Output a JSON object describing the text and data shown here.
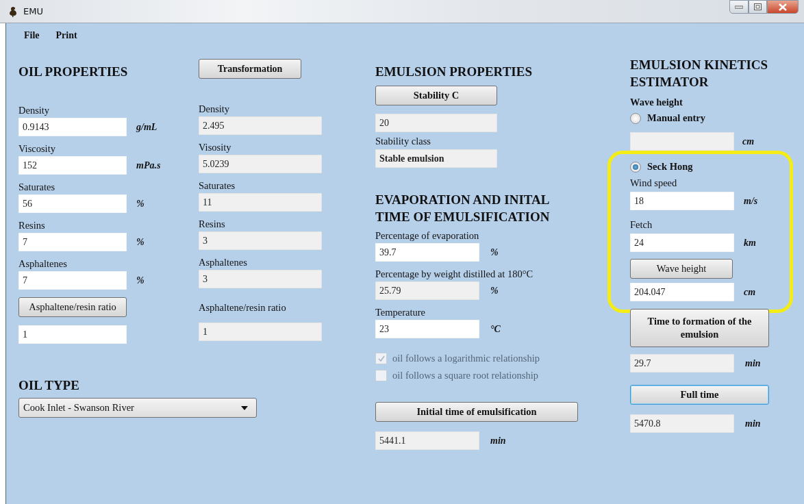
{
  "window": {
    "title": "EMU"
  },
  "menu": [
    {
      "label": "File"
    },
    {
      "label": "Print"
    }
  ],
  "oil_properties": {
    "title": "OIL PROPERTIES",
    "fields": [
      {
        "label": "Density",
        "value": "0.9143",
        "unit": "g/mL"
      },
      {
        "label": "Viscosity",
        "value": "152",
        "unit": "mPa.s"
      },
      {
        "label": "Saturates",
        "value": "56",
        "unit": "%"
      },
      {
        "label": "Resins",
        "value": "7",
        "unit": "%"
      },
      {
        "label": "Asphaltenes",
        "value": "7",
        "unit": "%"
      }
    ],
    "ratio_button": "Asphaltene/resin ratio",
    "ratio_value": "1"
  },
  "transformation": {
    "button": "Transformation",
    "fields": [
      {
        "label": "Density",
        "value": "2.495"
      },
      {
        "label": "Visosity",
        "value": "5.0239"
      },
      {
        "label": "Saturates",
        "value": "11"
      },
      {
        "label": "Resins",
        "value": "3"
      },
      {
        "label": "Asphaltenes",
        "value": "3"
      }
    ],
    "ratio_label": "Asphaltene/resin ratio",
    "ratio_value": "1"
  },
  "oil_type": {
    "title": "OIL TYPE",
    "selected": "Cook Inlet - Swanson River"
  },
  "emulsion_properties": {
    "title": "EMULSION PROPERTIES",
    "button": "Stability C",
    "value": "20",
    "class_label": "Stability class",
    "class_value": "Stable emulsion"
  },
  "evaporation": {
    "title": "EVAPORATION AND INITAL TIME OF EMULSIFICATION",
    "fields": [
      {
        "label": "Percentage of evaporation",
        "value": "39.7",
        "unit": "%",
        "editable": true
      },
      {
        "label": "Percentage by weight distilled at 180°C",
        "value": "25.79",
        "unit": "%",
        "editable": false
      },
      {
        "label": "Temperature",
        "value": "23",
        "unit": "°C",
        "editable": true
      }
    ],
    "options": [
      {
        "label": "oil follows a logarithmic relationship",
        "checked": true,
        "disabled": true
      },
      {
        "label": "oil follows a square root relationship",
        "checked": false,
        "disabled": true
      }
    ],
    "button": "Initial time of emulsification",
    "result": {
      "value": "5441.1",
      "unit": "min"
    }
  },
  "kinetics": {
    "title": "EMULSION KINETICS ESTIMATOR",
    "wave_label": "Wave height",
    "manual": {
      "label": "Manual entry",
      "selected": false,
      "unit": "cm"
    },
    "seck_hong": {
      "label": "Seck Hong",
      "selected": true,
      "highlighted": true,
      "fields": [
        {
          "label": "Wind speed",
          "value": "18",
          "unit": "m/s"
        },
        {
          "label": "Fetch",
          "value": "24",
          "unit": "km"
        }
      ],
      "button": "Wave height",
      "result": {
        "value": "204.047",
        "unit": "cm"
      }
    },
    "time_button": "Time to formation of the emulsion",
    "time_result": {
      "value": "29.7",
      "unit": "min"
    },
    "full_button": {
      "label": "Full time",
      "focused": true
    },
    "full_result": {
      "value": "5470.8",
      "unit": "min"
    }
  }
}
